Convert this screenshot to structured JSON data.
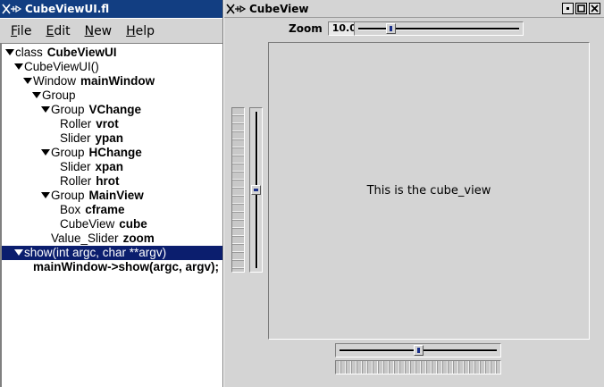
{
  "editor_window": {
    "title": "CubeViewUI.fl",
    "menu": [
      {
        "label": "File",
        "mnemonic": "F",
        "rest": "ile"
      },
      {
        "label": "Edit",
        "mnemonic": "E",
        "rest": "dit"
      },
      {
        "label": "New",
        "mnemonic": "N",
        "rest": "ew"
      },
      {
        "label": "Help",
        "mnemonic": "H",
        "rest": "elp"
      }
    ],
    "tree": [
      {
        "type": "class",
        "name": "CubeViewUI",
        "expanded": true,
        "depth": 0
      },
      {
        "type": "CubeViewUI()",
        "name": "",
        "expanded": true,
        "depth": 1
      },
      {
        "type": "Window",
        "name": "mainWindow",
        "expanded": true,
        "depth": 2
      },
      {
        "type": "Group",
        "name": "",
        "expanded": true,
        "depth": 3
      },
      {
        "type": "Group",
        "name": "VChange",
        "expanded": true,
        "depth": 4
      },
      {
        "type": "Roller",
        "name": "vrot",
        "expanded": false,
        "depth": 5
      },
      {
        "type": "Slider",
        "name": "ypan",
        "expanded": false,
        "depth": 5
      },
      {
        "type": "Group",
        "name": "HChange",
        "expanded": true,
        "depth": 4
      },
      {
        "type": "Slider",
        "name": "xpan",
        "expanded": false,
        "depth": 5
      },
      {
        "type": "Roller",
        "name": "hrot",
        "expanded": false,
        "depth": 5
      },
      {
        "type": "Group",
        "name": "MainView",
        "expanded": true,
        "depth": 4
      },
      {
        "type": "Box",
        "name": "cframe",
        "expanded": false,
        "depth": 5
      },
      {
        "type": "CubeView",
        "name": "cube",
        "expanded": false,
        "depth": 5
      },
      {
        "type": "Value_Slider",
        "name": "zoom",
        "expanded": false,
        "depth": 4
      },
      {
        "type": "show(int argc, char **argv)",
        "name": "",
        "expanded": true,
        "depth": 1,
        "selected": true
      },
      {
        "type": "",
        "name": "mainWindow->show(argc, argv);",
        "expanded": false,
        "depth": 2
      }
    ]
  },
  "cube_window": {
    "title": "CubeView",
    "zoom_label": "Zoom",
    "zoom_value": "10.0",
    "zoom_slider_fraction": 0.2,
    "ypan_fraction": 0.5,
    "xpan_fraction": 0.5,
    "cube_text": "This is the cube_view"
  },
  "colors": {
    "active_title": "#123e82",
    "selection": "#0b1e6e",
    "window_bg": "#d4d4d4"
  }
}
